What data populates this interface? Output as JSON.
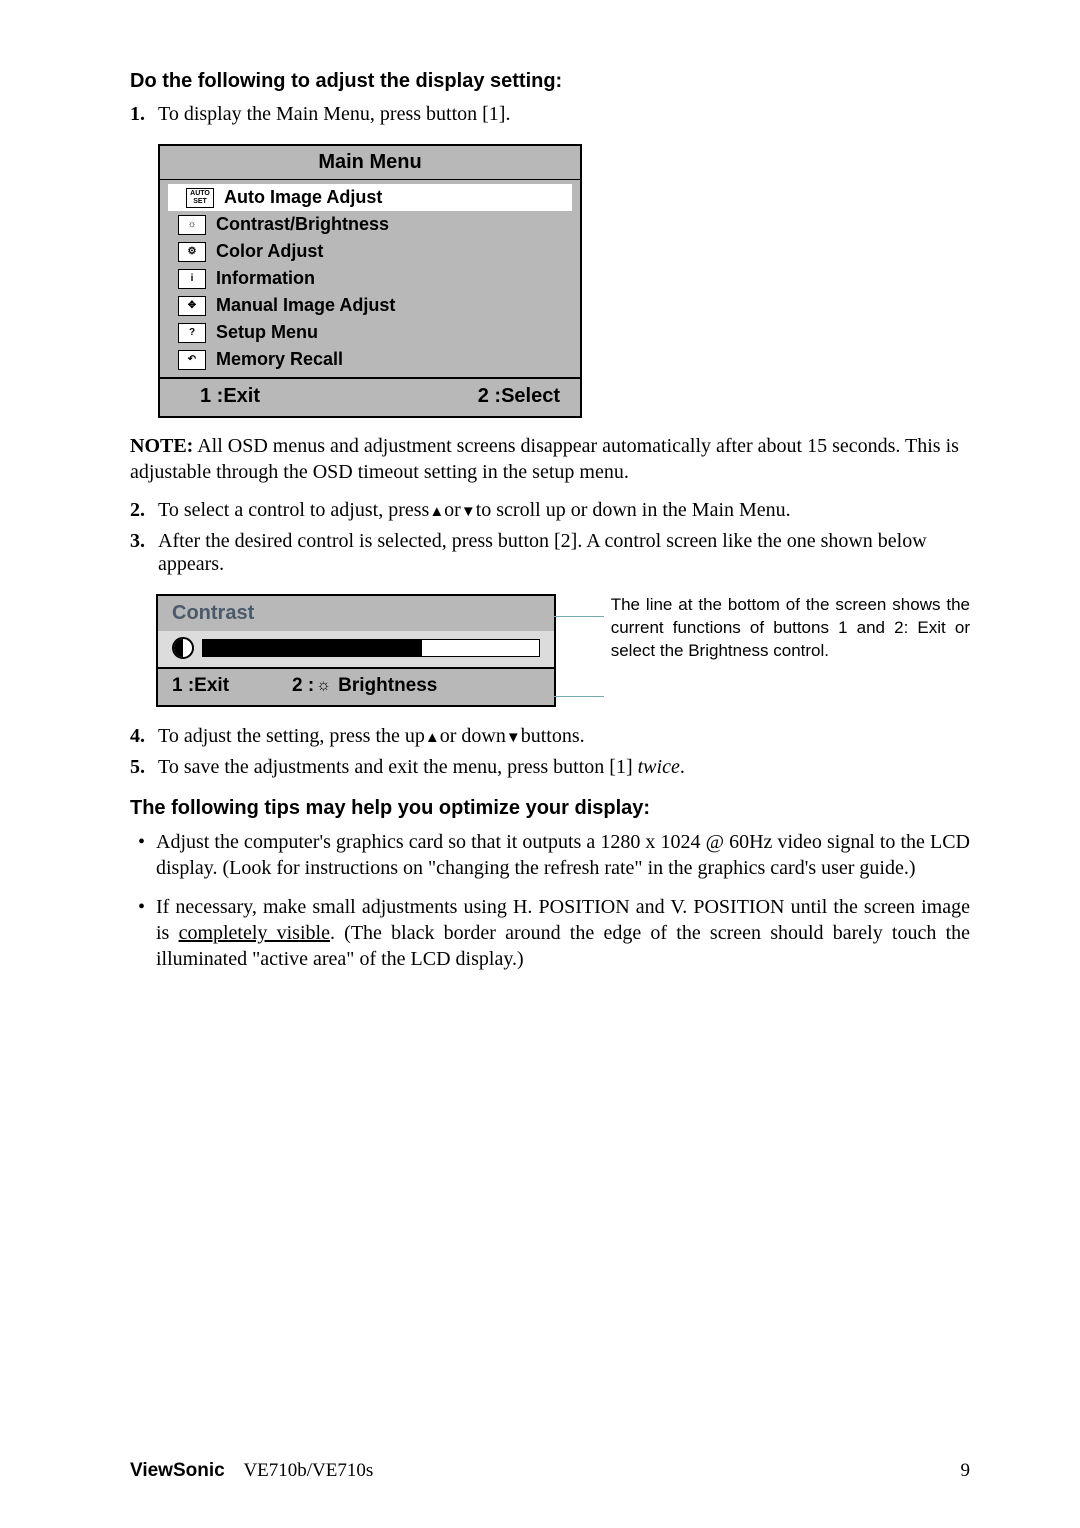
{
  "heading1": "Do the following to adjust the display setting:",
  "step1": {
    "num": "1.",
    "text": "To display the Main Menu, press button [1]."
  },
  "osd": {
    "title": "Main Menu",
    "rows": [
      {
        "icon": "AUTO\nSET",
        "label": "Auto Image Adjust",
        "selected": true
      },
      {
        "icon": "☼",
        "label": "Contrast/Brightness",
        "selected": false
      },
      {
        "icon": "⚙",
        "label": "Color Adjust",
        "selected": false
      },
      {
        "icon": "i",
        "label": "Information",
        "selected": false
      },
      {
        "icon": "✥",
        "label": "Manual Image Adjust",
        "selected": false
      },
      {
        "icon": "?",
        "label": "Setup Menu",
        "selected": false
      },
      {
        "icon": "↶",
        "label": "Memory Recall",
        "selected": false
      }
    ],
    "footer_left": "1 :Exit",
    "footer_right": "2 :Select"
  },
  "note": {
    "label": "NOTE:",
    "text": " All OSD menus and adjustment screens disappear automatically after about 15 seconds. This is adjustable through the OSD timeout setting in the setup menu."
  },
  "step2": {
    "num": "2.",
    "text_a": "To select a control to adjust, press",
    "text_b": "or",
    "text_c": "to scroll up or down in the Main Menu."
  },
  "step3": {
    "num": "3.",
    "text": "After the desired control is selected, press button [2]. A control screen like the one shown below appears."
  },
  "contrast": {
    "title": "Contrast",
    "footer_left": "1 :Exit",
    "footer_right": "2 : ☼ Brightness"
  },
  "callout": "The line at the bottom of the screen shows the current functions of buttons 1 and 2: Exit or select the Brightness control.",
  "step4": {
    "num": "4.",
    "text_a": "To adjust the setting, press the up",
    "text_b": "or down",
    "text_c": "buttons."
  },
  "step5": {
    "num": "5.",
    "text_a": "To save the adjustments and exit the menu, press button [1] ",
    "text_em": "twice",
    "text_b": "."
  },
  "heading2": "The following tips may help you optimize your display:",
  "bullet1": "Adjust the computer's graphics card so that it outputs a 1280 x 1024 @ 60Hz video signal to the LCD display. (Look for instructions on \"changing the refresh rate\" in the graphics card's user guide.)",
  "bullet2_a": "If necessary, make small adjustments using H. POSITION and V. POSITION until the screen image is ",
  "bullet2_u": "completely visible",
  "bullet2_b": ". (The black border around the edge of the screen should barely touch the illuminated \"active area\" of the LCD display.)",
  "footer": {
    "brand": "ViewSonic",
    "model": "VE710b/VE710s",
    "page": "9"
  }
}
